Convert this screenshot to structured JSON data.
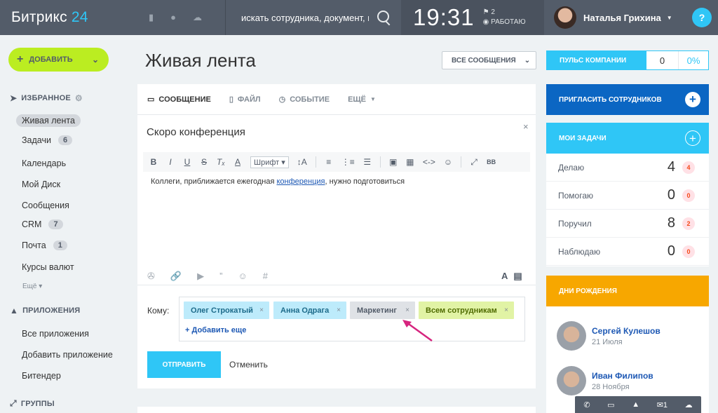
{
  "header": {
    "logo_name": "Битрикс",
    "logo_num": "24",
    "search_text": "искать сотрудника, документ, пр",
    "time": "19:31",
    "flag_count": "2",
    "work_status": "РАБОТАЮ",
    "user_name": "Наталья Грихина",
    "help": "?"
  },
  "sidebar": {
    "add_label": "ДОБАВИТЬ",
    "favorites_label": "ИЗБРАННОЕ",
    "items": [
      {
        "label": "Живая лента",
        "count": ""
      },
      {
        "label": "Задачи",
        "count": "6"
      },
      {
        "label": "Календарь",
        "count": ""
      },
      {
        "label": "Мой Диск",
        "count": ""
      },
      {
        "label": "Сообщения",
        "count": ""
      },
      {
        "label": "CRM",
        "count": "7"
      },
      {
        "label": "Почта",
        "count": "1"
      },
      {
        "label": "Курсы валют",
        "count": ""
      }
    ],
    "more": "Ещё",
    "apps_label": "ПРИЛОЖЕНИЯ",
    "apps": [
      "Все приложения",
      "Добавить приложение",
      "Битендер"
    ],
    "groups_label": "ГРУППЫ"
  },
  "main": {
    "title": "Живая лента",
    "filter": "ВСЕ СООБЩЕНИЯ",
    "tabs": [
      "СООБЩЕНИЕ",
      "ФАЙЛ",
      "СОБЫТИЕ",
      "ЕЩЁ"
    ],
    "subject": "Скоро конференция",
    "font_label": "Шрифт",
    "body_before": "Коллеги, приближается ежегодная ",
    "body_link": "конференция",
    "body_after": ", нужно подготовиться",
    "to_label": "Кому:",
    "recipients": [
      "Олег Строкатый",
      "Анна Одрага",
      "Маркетинг",
      "Всем сотрудникам"
    ],
    "add_more": "+ Добавить еще",
    "send": "ОТПРАВИТЬ",
    "cancel": "Отменить"
  },
  "right": {
    "pulse_label": "ПУЛЬС КОМПАНИИ",
    "pulse_value": "0",
    "pulse_percent": "0%",
    "invite_label": "ПРИГЛАСИТЬ СОТРУДНИКОВ",
    "tasks_label": "МОИ ЗАДАЧИ",
    "tasks": [
      {
        "label": "Делаю",
        "value": "4",
        "counter": "4"
      },
      {
        "label": "Помогаю",
        "value": "0",
        "counter": "0"
      },
      {
        "label": "Поручил",
        "value": "8",
        "counter": "2"
      },
      {
        "label": "Наблюдаю",
        "value": "0",
        "counter": "0"
      }
    ],
    "birthdays_label": "ДНИ РОЖДЕНИЯ",
    "birthdays": [
      {
        "name": "Сергей Кулешов",
        "date": "21 Июля"
      },
      {
        "name": "Иван Филипов",
        "date": "28 Ноября"
      }
    ],
    "dock_mail_count": "1"
  },
  "colors": {
    "header": "#535c69",
    "accent": "#2fc6f6",
    "add": "#bbed21",
    "invite": "#0b66c3",
    "birthdays": "#f7a700"
  }
}
